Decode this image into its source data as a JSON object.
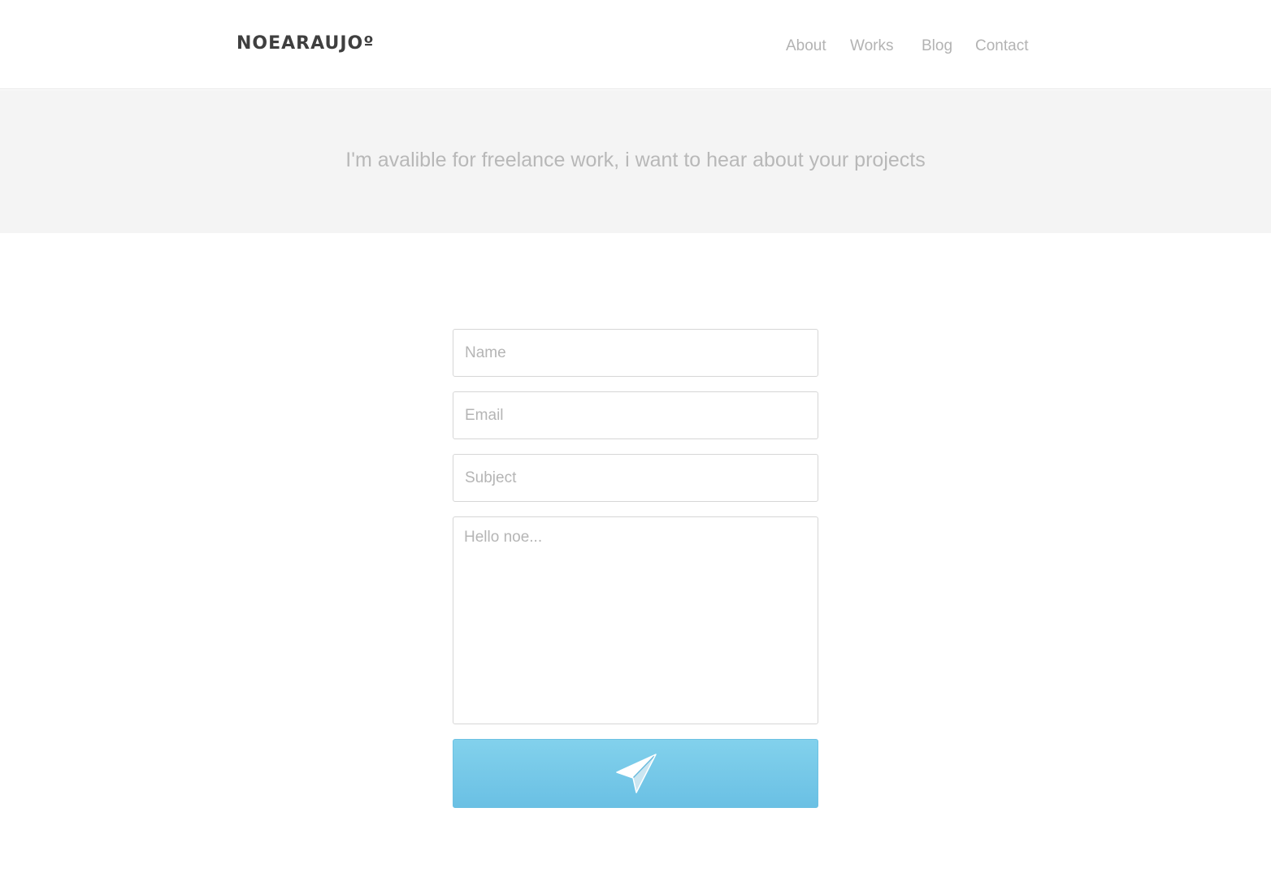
{
  "header": {
    "logo": "NOEARAUJOº",
    "nav": [
      {
        "label": "About"
      },
      {
        "label": "Works"
      },
      {
        "label": "Blog"
      },
      {
        "label": "Contact"
      }
    ]
  },
  "hero": {
    "text": "I'm avalible for freelance work, i want to hear about your projects"
  },
  "form": {
    "name_placeholder": "Name",
    "email_placeholder": "Email",
    "subject_placeholder": "Subject",
    "message_placeholder": "Hello noe...",
    "submit_icon": "paper-plane-icon"
  },
  "colors": {
    "button_top": "#82d1ec",
    "button_bottom": "#6ac0e4",
    "hero_background": "#f4f4f4",
    "logo": "#3f3f3f",
    "nav_text": "#b3b3b3"
  }
}
